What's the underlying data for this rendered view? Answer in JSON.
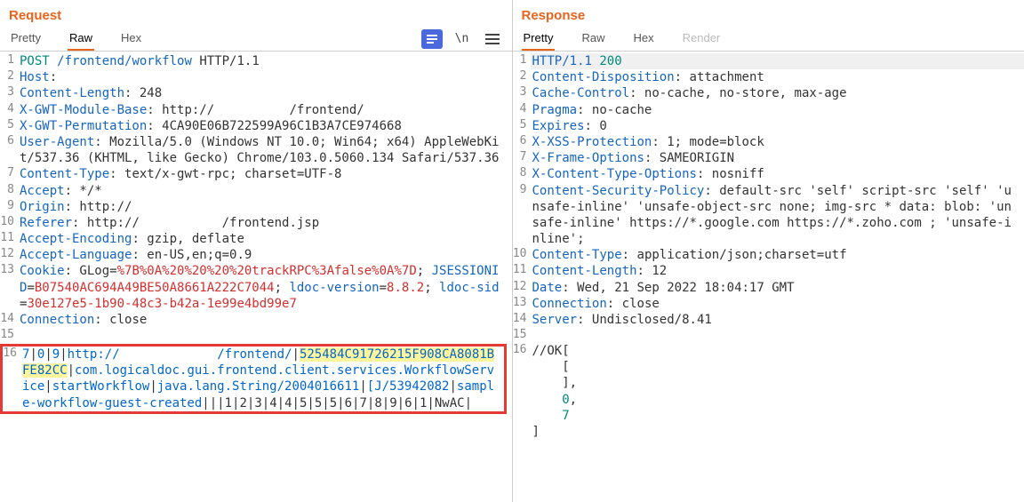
{
  "req": {
    "title": "Request",
    "tabs": {
      "pretty": "Pretty",
      "raw": "Raw",
      "hex": "Hex"
    },
    "active_tab": "raw",
    "toolbar": {
      "actions_icon": "actions",
      "newline_icon": "\\n",
      "menu_icon": "menu"
    },
    "lines": [
      {
        "n": 1,
        "segs": [
          {
            "t": "POST",
            "c": "tk-method"
          },
          {
            "t": " ",
            "c": "tk-text"
          },
          {
            "t": "/frontend/workflow",
            "c": "tk-path"
          },
          {
            "t": " ",
            "c": "tk-text"
          },
          {
            "t": "HTTP/1.1",
            "c": "tk-text"
          }
        ]
      },
      {
        "n": 2,
        "segs": [
          {
            "t": "Host",
            "c": "tk-key"
          },
          {
            "t": ": ",
            "c": "tk-text"
          }
        ]
      },
      {
        "n": 3,
        "segs": [
          {
            "t": "Content-Length",
            "c": "tk-key"
          },
          {
            "t": ": 248",
            "c": "tk-text"
          }
        ]
      },
      {
        "n": 4,
        "segs": [
          {
            "t": "X-GWT-Module-Base",
            "c": "tk-key"
          },
          {
            "t": ": http://",
            "c": "tk-text"
          },
          {
            "t": "          ",
            "c": "tk-text"
          },
          {
            "t": "/frontend/",
            "c": "tk-text"
          }
        ]
      },
      {
        "n": 5,
        "segs": [
          {
            "t": "X-GWT-Permutation",
            "c": "tk-key"
          },
          {
            "t": ": 4CA90E06B722599A96C1B3A7CE974668",
            "c": "tk-text"
          }
        ]
      },
      {
        "n": 6,
        "segs": [
          {
            "t": "User-Agent",
            "c": "tk-key"
          },
          {
            "t": ": Mozilla/5.0 (Windows NT 10.0; Win64; x64) AppleWebKit/537.36 (KHTML, like Gecko) Chrome/103.0.5060.134 Safari/537.36",
            "c": "tk-text"
          }
        ]
      },
      {
        "n": 7,
        "segs": [
          {
            "t": "Content-Type",
            "c": "tk-key"
          },
          {
            "t": ": text/x-gwt-rpc; charset=UTF-8",
            "c": "tk-text"
          }
        ]
      },
      {
        "n": 8,
        "segs": [
          {
            "t": "Accept",
            "c": "tk-key"
          },
          {
            "t": ": */*",
            "c": "tk-text"
          }
        ]
      },
      {
        "n": 9,
        "segs": [
          {
            "t": "Origin",
            "c": "tk-key"
          },
          {
            "t": ": http://",
            "c": "tk-text"
          }
        ]
      },
      {
        "n": 10,
        "segs": [
          {
            "t": "Referer",
            "c": "tk-key"
          },
          {
            "t": ": http://",
            "c": "tk-text"
          },
          {
            "t": "           ",
            "c": "tk-text"
          },
          {
            "t": "/frontend.jsp",
            "c": "tk-text"
          }
        ]
      },
      {
        "n": 11,
        "segs": [
          {
            "t": "Accept-Encoding",
            "c": "tk-key"
          },
          {
            "t": ": gzip, deflate",
            "c": "tk-text"
          }
        ]
      },
      {
        "n": 12,
        "segs": [
          {
            "t": "Accept-Language",
            "c": "tk-key"
          },
          {
            "t": ": en-US,en;q=0.9",
            "c": "tk-text"
          }
        ]
      },
      {
        "n": 13,
        "segs": [
          {
            "t": "Cookie",
            "c": "tk-key"
          },
          {
            "t": ": GLog=",
            "c": "tk-text"
          },
          {
            "t": "%7B%0A%20%20%20%20trackRPC%3Afalse%0A%7D",
            "c": "tk-cookie-red"
          },
          {
            "t": "; ",
            "c": "tk-text"
          },
          {
            "t": "JSESSIONID",
            "c": "tk-key"
          },
          {
            "t": "=",
            "c": "tk-text"
          },
          {
            "t": "B07540AC694A49BE50A8661A222C7044",
            "c": "tk-cookie-red"
          },
          {
            "t": "; ",
            "c": "tk-text"
          },
          {
            "t": "ldoc-version",
            "c": "tk-key"
          },
          {
            "t": "=",
            "c": "tk-text"
          },
          {
            "t": "8.8.2",
            "c": "tk-cookie-red"
          },
          {
            "t": "; ",
            "c": "tk-text"
          },
          {
            "t": "ldoc-sid",
            "c": "tk-key"
          },
          {
            "t": "=",
            "c": "tk-text"
          },
          {
            "t": "30e127e5-1b90-48c3-b42a-1e99e4bd99e7",
            "c": "tk-cookie-red"
          }
        ]
      },
      {
        "n": 14,
        "segs": [
          {
            "t": "Connection",
            "c": "tk-key"
          },
          {
            "t": ": close",
            "c": "tk-text"
          }
        ]
      },
      {
        "n": 15,
        "segs": [
          {
            "t": "",
            "c": "tk-text"
          }
        ]
      }
    ],
    "body": {
      "n_start": 16,
      "row1": [
        {
          "t": "7",
          "c": "body-blue"
        },
        {
          "t": "|",
          "c": "pipe"
        },
        {
          "t": "0",
          "c": "body-blue"
        },
        {
          "t": "|",
          "c": "pipe"
        },
        {
          "t": "9",
          "c": "body-blue"
        },
        {
          "t": "|",
          "c": "pipe"
        },
        {
          "t": "http://",
          "c": "body-blue"
        },
        {
          "t": "             ",
          "c": "body-black"
        },
        {
          "t": "/frontend/",
          "c": "body-blue"
        },
        {
          "t": "|",
          "c": "pipe"
        },
        {
          "t": "525484C91726215F908CA8081BFE82CC",
          "c": "tk-highlight"
        },
        {
          "t": "|",
          "c": "pipe"
        },
        {
          "t": "com.logicaldoc.gui.frontend.client.services.WorkflowService",
          "c": "body-blue"
        },
        {
          "t": "|",
          "c": "pipe"
        },
        {
          "t": "startWorkflow",
          "c": "body-blue"
        },
        {
          "t": "|",
          "c": "pipe"
        },
        {
          "t": "java.lang.String/2004016611",
          "c": "body-blue"
        },
        {
          "t": "|",
          "c": "pipe"
        },
        {
          "t": "[J/53942082",
          "c": "body-blue"
        },
        {
          "t": "|",
          "c": "pipe"
        },
        {
          "t": "sample-workflow-guest-created",
          "c": "body-blue"
        },
        {
          "t": "|",
          "c": "pipe"
        },
        {
          "t": "|",
          "c": "pipe"
        },
        {
          "t": "|",
          "c": "pipe"
        },
        {
          "t": "1",
          "c": "body-black"
        },
        {
          "t": "|",
          "c": "pipe"
        },
        {
          "t": "2",
          "c": "body-black"
        },
        {
          "t": "|",
          "c": "pipe"
        },
        {
          "t": "3",
          "c": "body-black"
        },
        {
          "t": "|",
          "c": "pipe"
        },
        {
          "t": "4",
          "c": "body-black"
        },
        {
          "t": "|",
          "c": "pipe"
        },
        {
          "t": "4",
          "c": "body-black"
        },
        {
          "t": "|",
          "c": "pipe"
        },
        {
          "t": "5",
          "c": "body-black"
        },
        {
          "t": "|",
          "c": "pipe"
        },
        {
          "t": "5",
          "c": "body-black"
        },
        {
          "t": "|",
          "c": "pipe"
        },
        {
          "t": "5",
          "c": "body-black"
        },
        {
          "t": "|",
          "c": "pipe"
        },
        {
          "t": "6",
          "c": "body-black"
        },
        {
          "t": "|",
          "c": "pipe"
        },
        {
          "t": "7",
          "c": "body-black"
        },
        {
          "t": "|",
          "c": "pipe"
        },
        {
          "t": "8",
          "c": "body-black"
        },
        {
          "t": "|",
          "c": "pipe"
        },
        {
          "t": "9",
          "c": "body-black"
        },
        {
          "t": "|",
          "c": "pipe"
        },
        {
          "t": "6",
          "c": "body-black"
        },
        {
          "t": "|",
          "c": "pipe"
        },
        {
          "t": "1",
          "c": "body-black"
        },
        {
          "t": "|",
          "c": "pipe"
        },
        {
          "t": "NwAC",
          "c": "body-black"
        },
        {
          "t": "|",
          "c": "pipe"
        }
      ]
    }
  },
  "resp": {
    "title": "Response",
    "tabs": {
      "pretty": "Pretty",
      "raw": "Raw",
      "hex": "Hex",
      "render": "Render"
    },
    "active_tab": "pretty",
    "lines": [
      {
        "n": 1,
        "first": true,
        "segs": [
          {
            "t": "HTTP/1.1",
            "c": "tk-key"
          },
          {
            "t": " ",
            "c": "tk-text"
          },
          {
            "t": "200",
            "c": "tk-method"
          }
        ]
      },
      {
        "n": 2,
        "segs": [
          {
            "t": "Content-Disposition",
            "c": "tk-key"
          },
          {
            "t": ": attachment",
            "c": "tk-text"
          }
        ]
      },
      {
        "n": 3,
        "segs": [
          {
            "t": "Cache-Control",
            "c": "tk-key"
          },
          {
            "t": ": no-cache, no-store, max-age",
            "c": "tk-text"
          }
        ]
      },
      {
        "n": 4,
        "segs": [
          {
            "t": "Pragma",
            "c": "tk-key"
          },
          {
            "t": ": no-cache",
            "c": "tk-text"
          }
        ]
      },
      {
        "n": 5,
        "segs": [
          {
            "t": "Expires",
            "c": "tk-key"
          },
          {
            "t": ": 0",
            "c": "tk-text"
          }
        ]
      },
      {
        "n": 6,
        "segs": [
          {
            "t": "X-XSS-Protection",
            "c": "tk-key"
          },
          {
            "t": ": 1; mode=block",
            "c": "tk-text"
          }
        ]
      },
      {
        "n": 7,
        "segs": [
          {
            "t": "X-Frame-Options",
            "c": "tk-key"
          },
          {
            "t": ": SAMEORIGIN",
            "c": "tk-text"
          }
        ]
      },
      {
        "n": 8,
        "segs": [
          {
            "t": "X-Content-Type-Options",
            "c": "tk-key"
          },
          {
            "t": ": nosniff",
            "c": "tk-text"
          }
        ]
      },
      {
        "n": 9,
        "segs": [
          {
            "t": "Content-Security-Policy",
            "c": "tk-key"
          },
          {
            "t": ": default-src 'self' script-src 'self' 'unsafe-inline' 'unsafe-object-src none; img-src * data: blob: 'unsafe-inline' https://*.google.com https://*.zoho.com ; 'unsafe-inline';",
            "c": "tk-text"
          }
        ]
      },
      {
        "n": 10,
        "segs": [
          {
            "t": "Content-Type",
            "c": "tk-key"
          },
          {
            "t": ": application/json;charset=utf",
            "c": "tk-text"
          }
        ]
      },
      {
        "n": 11,
        "segs": [
          {
            "t": "Content-Length",
            "c": "tk-key"
          },
          {
            "t": ": 12",
            "c": "tk-text"
          }
        ]
      },
      {
        "n": 12,
        "segs": [
          {
            "t": "Date",
            "c": "tk-key"
          },
          {
            "t": ": Wed, 21 Sep 2022 18:04:17 GMT",
            "c": "tk-text"
          }
        ]
      },
      {
        "n": 13,
        "segs": [
          {
            "t": "Connection",
            "c": "tk-key"
          },
          {
            "t": ": close",
            "c": "tk-text"
          }
        ]
      },
      {
        "n": 14,
        "segs": [
          {
            "t": "Server",
            "c": "tk-key"
          },
          {
            "t": ": Undisclosed/8.41",
            "c": "tk-text"
          }
        ]
      },
      {
        "n": 15,
        "segs": [
          {
            "t": "",
            "c": "tk-text"
          }
        ]
      },
      {
        "n": 16,
        "segs": [
          {
            "t": "//OK[",
            "c": "tk-text"
          }
        ]
      },
      {
        "n": "",
        "segs": [
          {
            "t": "    [",
            "c": "tk-text"
          }
        ]
      },
      {
        "n": "",
        "segs": [
          {
            "t": "    ],",
            "c": "tk-text"
          }
        ]
      },
      {
        "n": "",
        "segs": [
          {
            "t": "    ",
            "c": "tk-text"
          },
          {
            "t": "0",
            "c": "tk-method"
          },
          {
            "t": ",",
            "c": "tk-text"
          }
        ]
      },
      {
        "n": "",
        "segs": [
          {
            "t": "    ",
            "c": "tk-text"
          },
          {
            "t": "7",
            "c": "tk-method"
          }
        ]
      },
      {
        "n": "",
        "segs": [
          {
            "t": "]",
            "c": "tk-text"
          }
        ]
      }
    ]
  }
}
